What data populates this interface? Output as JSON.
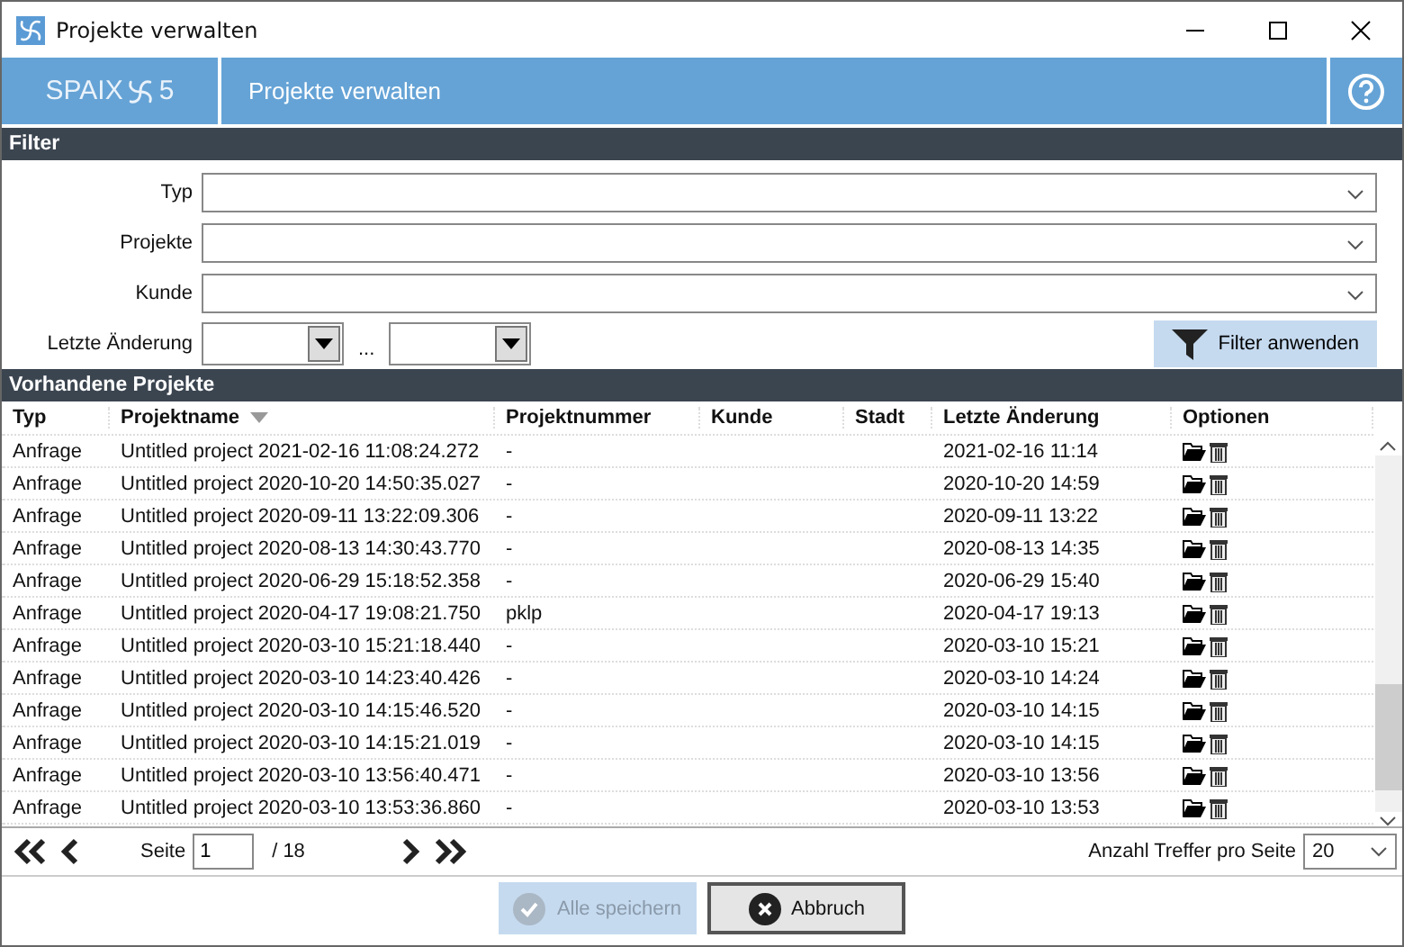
{
  "window": {
    "title": "Projekte verwalten"
  },
  "header": {
    "logo_text": "SPAIX",
    "logo_version": "5",
    "title": "Projekte verwalten"
  },
  "filter": {
    "title": "Filter",
    "fields": [
      {
        "label": "Typ",
        "kind": "combo"
      },
      {
        "label": "Projekte",
        "kind": "combo"
      },
      {
        "label": "Kunde",
        "kind": "combo"
      }
    ],
    "date_label": "Letzte Änderung",
    "date_separator": "...",
    "apply_button": "Filter anwenden"
  },
  "table": {
    "title": "Vorhandene Projekte",
    "columns": [
      {
        "label": "Typ",
        "sorted": false
      },
      {
        "label": "Projektname",
        "sorted": true
      },
      {
        "label": "Projektnummer",
        "sorted": false
      },
      {
        "label": "Kunde",
        "sorted": false
      },
      {
        "label": "Stadt",
        "sorted": false
      },
      {
        "label": "Letzte Änderung",
        "sorted": false
      },
      {
        "label": "Optionen",
        "sorted": false
      }
    ],
    "rows": [
      {
        "typ": "Anfrage",
        "name": "Untitled project 2021-02-16 11:08:24.272",
        "number": "-",
        "changed": "2021-02-16 11:14"
      },
      {
        "typ": "Anfrage",
        "name": "Untitled project 2020-10-20 14:50:35.027",
        "number": "-",
        "changed": "2020-10-20 14:59"
      },
      {
        "typ": "Anfrage",
        "name": "Untitled project 2020-09-11 13:22:09.306",
        "number": "-",
        "changed": "2020-09-11 13:22"
      },
      {
        "typ": "Anfrage",
        "name": "Untitled project 2020-08-13 14:30:43.770",
        "number": "-",
        "changed": "2020-08-13 14:35"
      },
      {
        "typ": "Anfrage",
        "name": "Untitled project 2020-06-29 15:18:52.358",
        "number": "-",
        "changed": "2020-06-29 15:40"
      },
      {
        "typ": "Anfrage",
        "name": "Untitled project 2020-04-17 19:08:21.750",
        "number": "pklp",
        "changed": "2020-04-17 19:13"
      },
      {
        "typ": "Anfrage",
        "name": "Untitled project 2020-03-10 15:21:18.440",
        "number": "-",
        "changed": "2020-03-10 15:21"
      },
      {
        "typ": "Anfrage",
        "name": "Untitled project 2020-03-10 14:23:40.426",
        "number": "-",
        "changed": "2020-03-10 14:24"
      },
      {
        "typ": "Anfrage",
        "name": "Untitled project 2020-03-10 14:15:46.520",
        "number": "-",
        "changed": "2020-03-10 14:15"
      },
      {
        "typ": "Anfrage",
        "name": "Untitled project 2020-03-10 14:15:21.019",
        "number": "-",
        "changed": "2020-03-10 14:15"
      },
      {
        "typ": "Anfrage",
        "name": "Untitled project 2020-03-10 13:56:40.471",
        "number": "-",
        "changed": "2020-03-10 13:56"
      },
      {
        "typ": "Anfrage",
        "name": "Untitled project 2020-03-10 13:53:36.860",
        "number": "-",
        "changed": "2020-03-10 13:53"
      }
    ]
  },
  "pager": {
    "page_label": "Seite",
    "page": "1",
    "total": "/ 18",
    "per_page_label": "Anzahl Treffer pro Seite",
    "per_page": "20"
  },
  "buttons": [
    {
      "label": "Alle speichern",
      "kind": "save",
      "disabled": true
    },
    {
      "label": "Abbruch",
      "kind": "cancel",
      "disabled": false
    }
  ]
}
